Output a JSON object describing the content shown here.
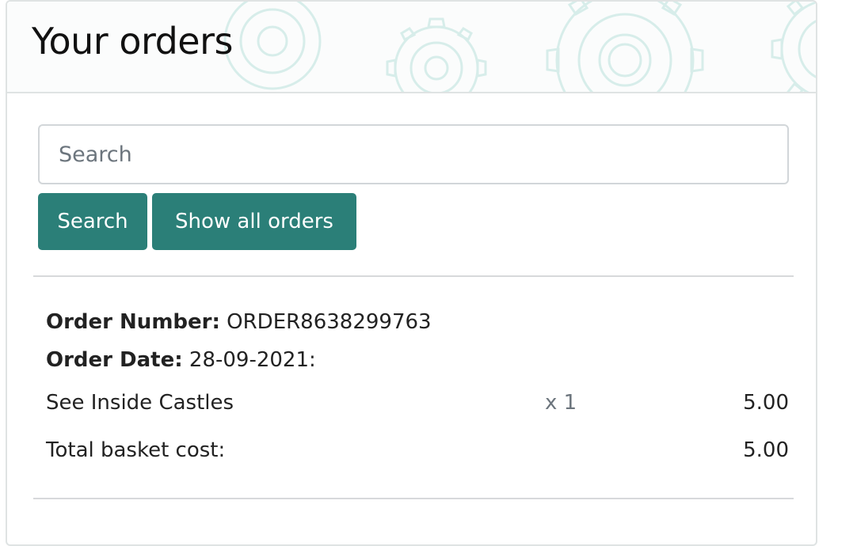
{
  "header": {
    "title": "Your orders"
  },
  "search": {
    "placeholder": "Search",
    "value": "",
    "button_label": "Search",
    "show_all_label": "Show all orders"
  },
  "colors": {
    "accent": "#2b7f78",
    "gear_decoration": "#cde9e5"
  },
  "order": {
    "number_label": "Order Number:",
    "number_value": " ORDER8638299763",
    "date_label": "Order Date:",
    "date_value": " 28-09-2021:",
    "items": [
      {
        "name": "See Inside Castles",
        "qty": "x 1",
        "price": "5.00"
      }
    ],
    "total_label": "Total basket cost:",
    "total_value": "5.00"
  }
}
